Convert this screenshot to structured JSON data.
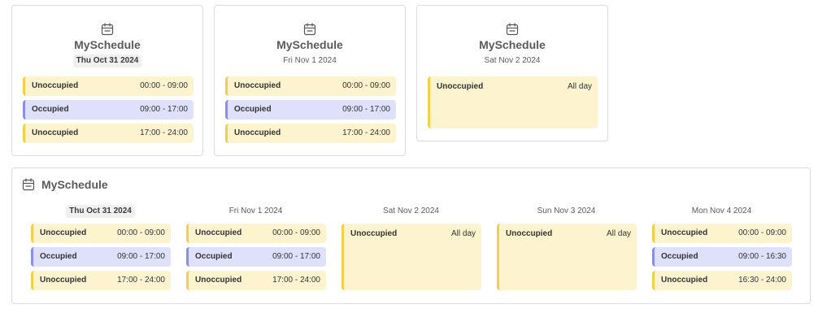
{
  "title": "MySchedule",
  "colors": {
    "unoccupied_bg": "#fdf3cf",
    "unoccupied_border": "#f2cf4a",
    "occupied_bg": "#dfe0fb",
    "occupied_border": "#8a8ee6"
  },
  "day_cards": [
    {
      "date": "Thu Oct 31 2024",
      "today": true,
      "slots": [
        {
          "label": "Unoccupied",
          "time": "00:00 - 09:00",
          "status": "unoccupied"
        },
        {
          "label": "Occupied",
          "time": "09:00 - 17:00",
          "status": "occupied"
        },
        {
          "label": "Unoccupied",
          "time": "17:00 - 24:00",
          "status": "unoccupied"
        }
      ]
    },
    {
      "date": "Fri Nov 1 2024",
      "today": false,
      "slots": [
        {
          "label": "Unoccupied",
          "time": "00:00 - 09:00",
          "status": "unoccupied"
        },
        {
          "label": "Occupied",
          "time": "09:00 - 17:00",
          "status": "occupied"
        },
        {
          "label": "Unoccupied",
          "time": "17:00 - 24:00",
          "status": "unoccupied"
        }
      ]
    },
    {
      "date": "Sat Nov 2 2024",
      "today": false,
      "slots": [
        {
          "label": "Unoccupied",
          "time": "All day",
          "status": "unoccupied"
        }
      ]
    }
  ],
  "week": {
    "title": "MySchedule",
    "days": [
      {
        "date": "Thu Oct 31 2024",
        "today": true,
        "slots": [
          {
            "label": "Unoccupied",
            "time": "00:00 - 09:00",
            "status": "unoccupied"
          },
          {
            "label": "Occupied",
            "time": "09:00 - 17:00",
            "status": "occupied"
          },
          {
            "label": "Unoccupied",
            "time": "17:00 - 24:00",
            "status": "unoccupied"
          }
        ]
      },
      {
        "date": "Fri Nov 1 2024",
        "today": false,
        "slots": [
          {
            "label": "Unoccupied",
            "time": "00:00 - 09:00",
            "status": "unoccupied"
          },
          {
            "label": "Occupied",
            "time": "09:00 - 17:00",
            "status": "occupied"
          },
          {
            "label": "Unoccupied",
            "time": "17:00 - 24:00",
            "status": "unoccupied"
          }
        ]
      },
      {
        "date": "Sat Nov 2 2024",
        "today": false,
        "slots": [
          {
            "label": "Unoccupied",
            "time": "All day",
            "status": "unoccupied"
          }
        ]
      },
      {
        "date": "Sun Nov 3 2024",
        "today": false,
        "slots": [
          {
            "label": "Unoccupied",
            "time": "All day",
            "status": "unoccupied"
          }
        ]
      },
      {
        "date": "Mon Nov 4 2024",
        "today": false,
        "slots": [
          {
            "label": "Unoccupied",
            "time": "00:00 - 09:00",
            "status": "unoccupied"
          },
          {
            "label": "Occupied",
            "time": "09:00 - 16:30",
            "status": "occupied"
          },
          {
            "label": "Unoccupied",
            "time": "16:30 - 24:00",
            "status": "unoccupied"
          }
        ]
      }
    ]
  }
}
